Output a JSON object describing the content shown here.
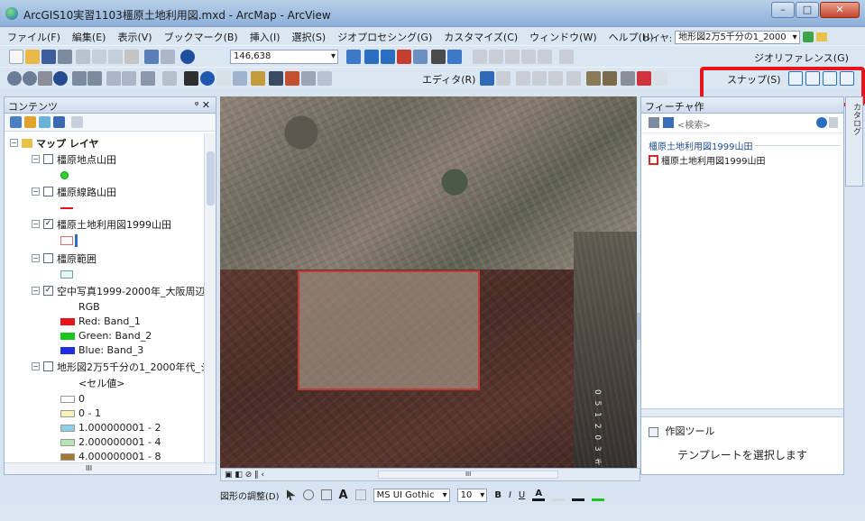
{
  "window": {
    "title": "ArcGIS10実習1103橿原土地利用図.mxd - ArcMap - ArcView",
    "minimize": "–",
    "maximize": "□",
    "close": "✕"
  },
  "menubar": {
    "items": [
      "ファイル(F)",
      "編集(E)",
      "表示(V)",
      "ブックマーク(B)",
      "挿入(I)",
      "選択(S)",
      "ジオプロセシング(G)",
      "カスタマイズ(C)",
      "ウィンドウ(W)",
      "ヘルプ(H)"
    ],
    "layer_label": "レイヤ:",
    "layer_value": "地形図2万5千分の1_2000"
  },
  "toolbar": {
    "scale": "146,638",
    "georef_label": "ジオリファレンス(G)",
    "editor_label": "エディタ(R)",
    "snap_label": "スナップ(S)"
  },
  "toc": {
    "title": "コンテンツ",
    "pin": "ᵠ ✕",
    "root": "マップ レイヤ",
    "layers": [
      {
        "name": "橿原地点山田",
        "checked": false
      },
      {
        "name": "橿原線路山田",
        "checked": false
      },
      {
        "name": "橿原土地利用図1999山田",
        "checked": true
      },
      {
        "name": "橿原範囲",
        "checked": false
      },
      {
        "name": "空中写真1999-2000年_大阪周辺",
        "checked": true
      },
      {
        "name": "地形図2万5千分の1_2000年代_ジ",
        "checked": false
      }
    ],
    "rgb_label": "RGB",
    "bands": [
      "Red:   Band_1",
      "Green: Band_2",
      "Blue:  Band_3"
    ],
    "band_colors": [
      "#e8141b",
      "#1ec41e",
      "#1e2ee0"
    ],
    "cell_label": "<セル値>",
    "classes": [
      {
        "label": "0",
        "color": "#ffffff"
      },
      {
        "label": "0 - 1",
        "color": "#f7f3b5"
      },
      {
        "label": "1.000000001 - 2",
        "color": "#8ed0ea"
      },
      {
        "label": "2.000000001 - 4",
        "color": "#b6e6b0"
      },
      {
        "label": "4.000000001 - 8",
        "color": "#a7782f"
      }
    ],
    "scroll_mark": "III"
  },
  "map": {
    "scalebar_text": "0 5 1 2 0 3 キ",
    "view_tabs": "▣ ◧  ⊘ ‖ ‹",
    "hscroll_mark": "III"
  },
  "features": {
    "title": "フィーチャ作",
    "search_placeholder": "<検索>",
    "group_label": "橿原土地利用図1999山田",
    "item_label": "橿原土地利用図1999山田",
    "tools_label": "作図ツール",
    "template_prompt": "テンプレートを選択します",
    "side_tab": "カタログ"
  },
  "drawbar": {
    "adjust_label": "図形の調整(D)",
    "font_name": "MS UI Gothic",
    "font_size": "10",
    "bold": "B",
    "italic": "I",
    "underline": "U"
  }
}
